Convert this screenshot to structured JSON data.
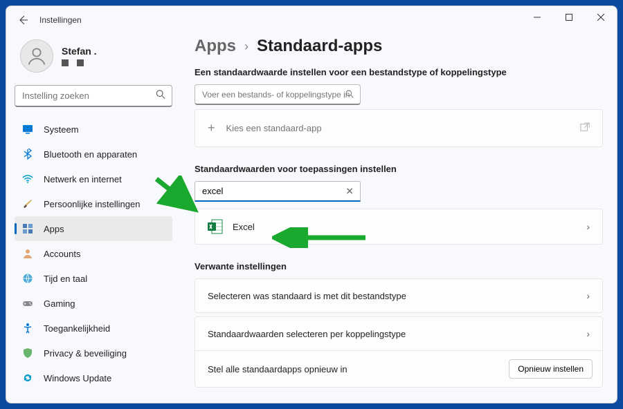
{
  "window": {
    "title": "Instellingen"
  },
  "profile": {
    "name": "Stefan ."
  },
  "search": {
    "placeholder": "Instelling zoeken"
  },
  "nav": {
    "items": [
      {
        "label": "Systeem",
        "icon": "display"
      },
      {
        "label": "Bluetooth en apparaten",
        "icon": "bluetooth"
      },
      {
        "label": "Netwerk en internet",
        "icon": "wifi"
      },
      {
        "label": "Persoonlijke instellingen",
        "icon": "brush"
      },
      {
        "label": "Apps",
        "icon": "apps",
        "active": true
      },
      {
        "label": "Accounts",
        "icon": "person"
      },
      {
        "label": "Tijd en taal",
        "icon": "globe"
      },
      {
        "label": "Gaming",
        "icon": "game"
      },
      {
        "label": "Toegankelijkheid",
        "icon": "access"
      },
      {
        "label": "Privacy & beveiliging",
        "icon": "shield"
      },
      {
        "label": "Windows Update",
        "icon": "update"
      }
    ]
  },
  "breadcrumb": {
    "parent": "Apps",
    "current": "Standaard-apps"
  },
  "sections": {
    "filetype_heading": "Een standaardwaarde instellen voor een bestandstype of koppelingstype",
    "filetype_placeholder": "Voer een bestands- of koppelingstype in",
    "choose_app_label": "Kies een standaard-app",
    "apps_heading": "Standaardwaarden voor toepassingen instellen",
    "app_search_value": "excel",
    "result_name": "Excel",
    "related_heading": "Verwante instellingen",
    "related_1": "Selecteren was standaard is met dit bestandstype",
    "related_2": "Standaardwaarden selecteren per koppelingstype",
    "reset_label": "Stel alle standaardapps opnieuw in",
    "reset_button": "Opnieuw instellen"
  }
}
